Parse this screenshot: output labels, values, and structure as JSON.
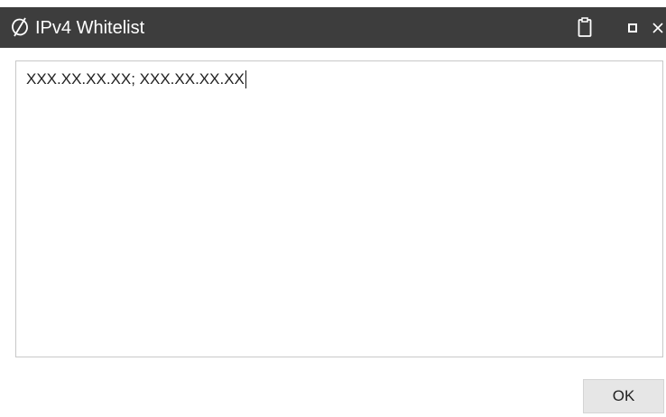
{
  "window": {
    "title": "IPv4 Whitelist",
    "title_icon": "slashed-circle-logo-icon",
    "controls": {
      "clipboard_icon": "clipboard-icon",
      "maximize_icon": "maximize-icon",
      "close_icon": "close-icon",
      "close_glyph": "×"
    }
  },
  "editor": {
    "value": "XXX.XX.XX.XX; XXX.XX.XX.XX"
  },
  "footer": {
    "ok_label": "OK"
  },
  "colors": {
    "titlebar_bg": "#3d3d3d",
    "titlebar_text": "#ffffff",
    "button_bg": "#e6e6e6",
    "field_border": "#c8c8c8"
  }
}
